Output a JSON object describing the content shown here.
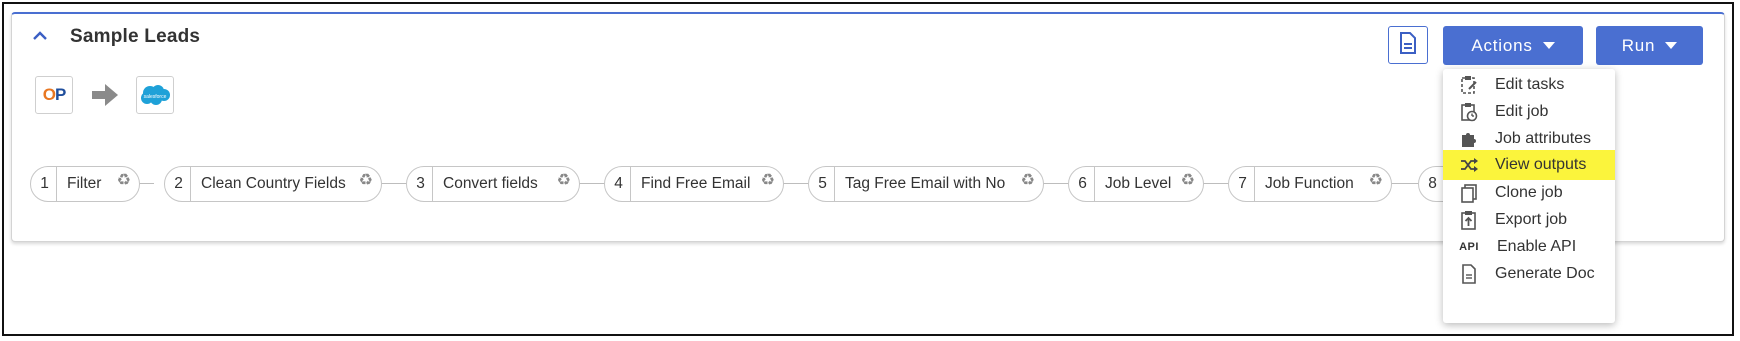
{
  "job": {
    "title": "Sample Leads"
  },
  "integration": {
    "source_icon": "op-logo-icon",
    "source_logo_text": {
      "o": "O",
      "p": "P"
    },
    "arrow_icon": "arrow-right-icon",
    "target_icon": "salesforce-logo-icon",
    "target_logo_text": "salesforce"
  },
  "toolbar": {
    "doc_icon": "document-icon",
    "actions_label": "Actions",
    "run_label": "Run",
    "button_color": "#4a6fd1"
  },
  "steps": [
    {
      "number": "1",
      "label": "Filter"
    },
    {
      "number": "2",
      "label": "Clean Country Fields"
    },
    {
      "number": "3",
      "label": "Convert fields"
    },
    {
      "number": "4",
      "label": "Find Free Email"
    },
    {
      "number": "5",
      "label": "Tag Free Email with No"
    },
    {
      "number": "6",
      "label": "Job Level"
    },
    {
      "number": "7",
      "label": "Job Function"
    },
    {
      "number": "8",
      "label": ""
    }
  ],
  "actions_menu": {
    "items": [
      {
        "label": "Edit tasks",
        "icon": "edit-tasks-icon"
      },
      {
        "label": "Edit job",
        "icon": "edit-job-icon"
      },
      {
        "label": "Job attributes",
        "icon": "puzzle-icon"
      },
      {
        "label": "View outputs",
        "icon": "shuffle-icon",
        "highlighted": true
      },
      {
        "label": "Clone job",
        "icon": "clone-icon"
      },
      {
        "label": "Export job",
        "icon": "export-icon"
      },
      {
        "label": "Enable API",
        "icon": "api-icon",
        "icon_text": "API"
      },
      {
        "label": "Generate Doc",
        "icon": "generate-doc-icon"
      }
    ],
    "highlight_color": "#fbf43c"
  }
}
